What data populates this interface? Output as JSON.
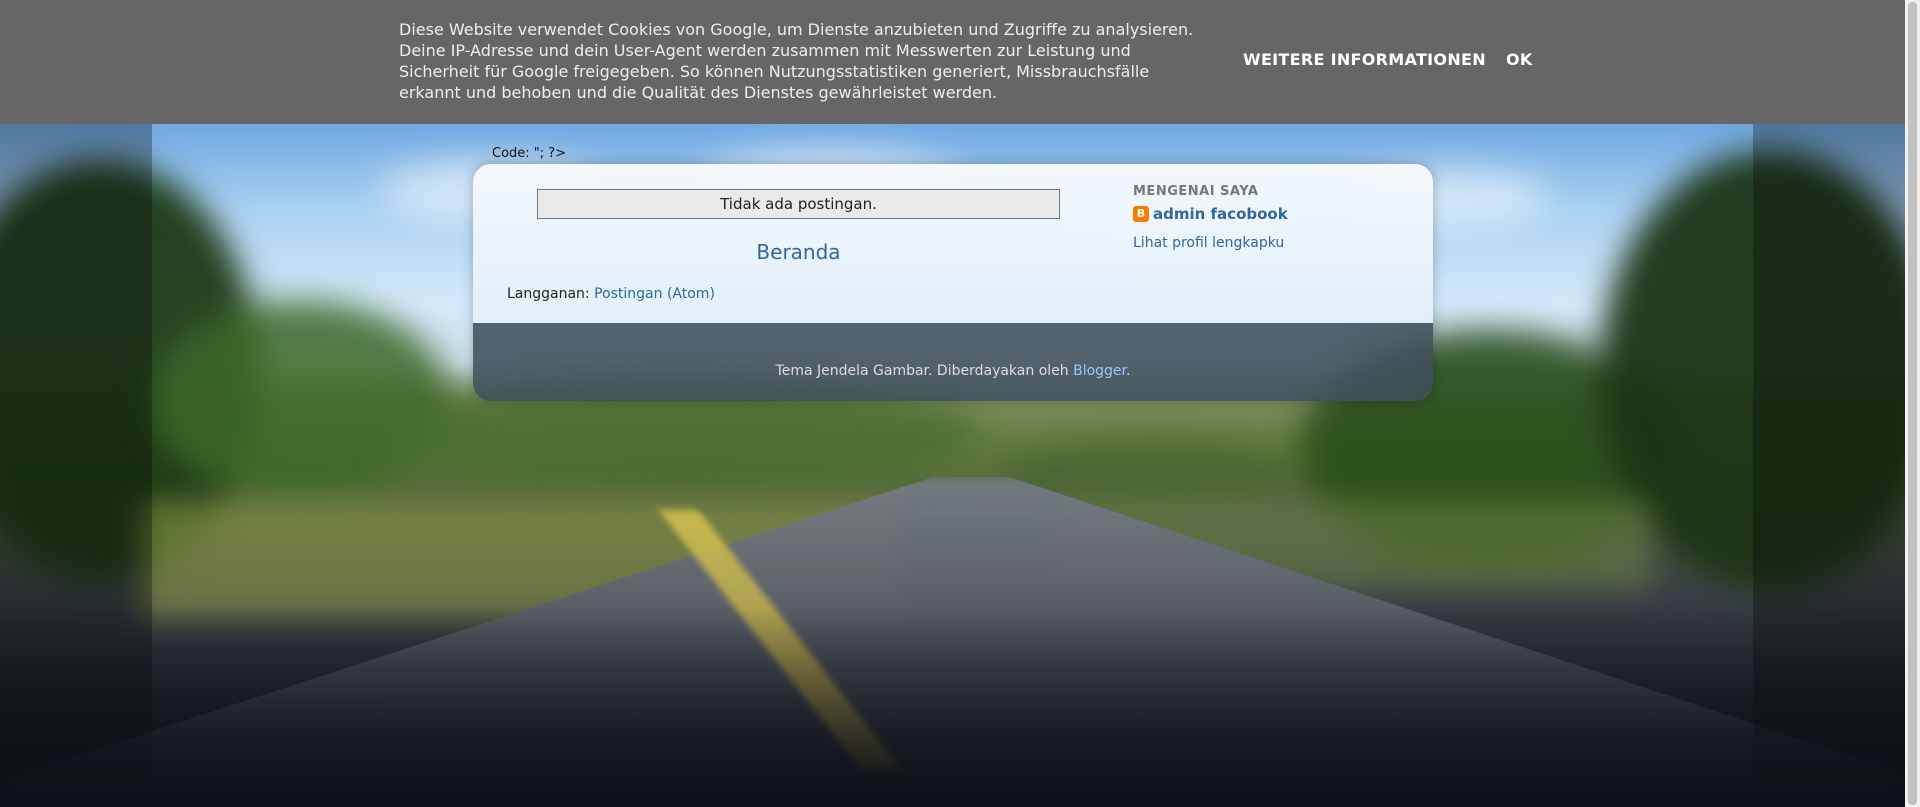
{
  "cookie_banner": {
    "line1": "Diese Website verwendet Cookies von Google, um Dienste anzubieten und Zugriffe zu analysieren.",
    "line2": "Deine IP-Adresse und dein User-Agent werden zusammen mit Messwerten zur Leistung und",
    "line3": "Sicherheit für Google freigegeben. So können Nutzungsstatistiken generiert, Missbrauchsfälle",
    "line4": "erkannt und behoben und die Qualität des Dienstes gewährleistet werden.",
    "more_info_label": "WEITERE INFORMATIONEN",
    "ok_label": "OK"
  },
  "code_line": "Code: \"; ?>",
  "main": {
    "no_posts": "Tidak ada postingan.",
    "home_link": "Beranda",
    "subscribe_label": "Langganan:",
    "subscribe_link": "Postingan (Atom)"
  },
  "sidebar": {
    "title": "MENGENAI SAYA",
    "profile_icon": "blogger-icon",
    "profile_name": "admin facobook",
    "profile_link": "Lihat profil lengkapku"
  },
  "footer": {
    "text": "Tema Jendela Gambar. Diberdayakan oleh ",
    "link": "Blogger",
    "suffix": "."
  },
  "colors": {
    "banner_bg": "#666666",
    "link": "#336699",
    "footer_link": "#99c7ff",
    "blogger_orange": "#f57d00"
  }
}
